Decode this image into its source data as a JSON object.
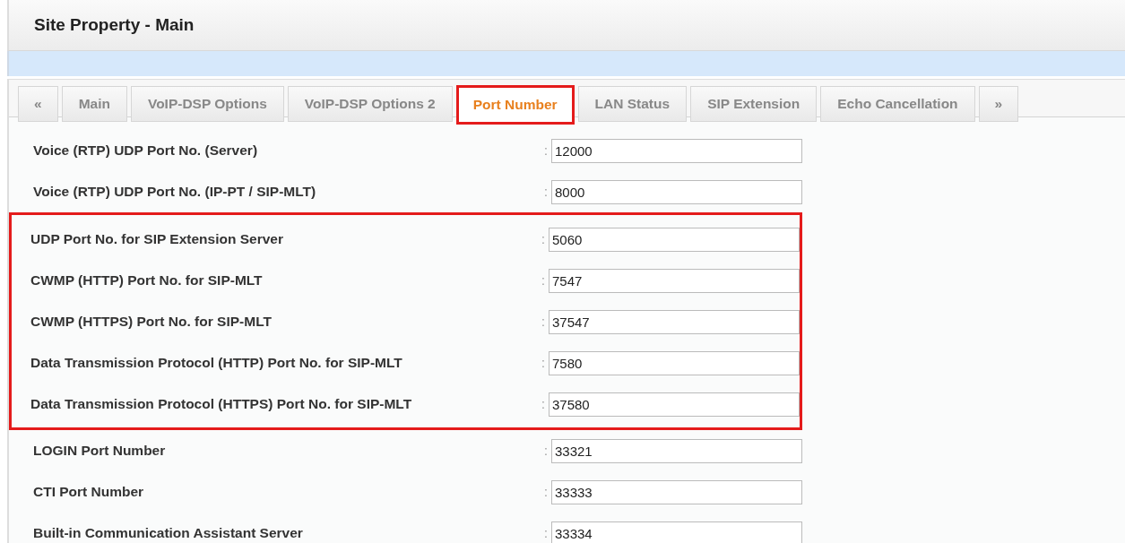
{
  "page_title": "Site Property - Main",
  "tabs": [
    {
      "label": "«",
      "kind": "arrow",
      "selected": false,
      "highlighted": false
    },
    {
      "label": "Main",
      "kind": "tab",
      "selected": false,
      "highlighted": false
    },
    {
      "label": "VoIP-DSP Options",
      "kind": "tab",
      "selected": false,
      "highlighted": false
    },
    {
      "label": "VoIP-DSP Options 2",
      "kind": "tab",
      "selected": false,
      "highlighted": false
    },
    {
      "label": "Port Number",
      "kind": "tab",
      "selected": true,
      "highlighted": true
    },
    {
      "label": "LAN Status",
      "kind": "tab",
      "selected": false,
      "highlighted": false
    },
    {
      "label": "SIP Extension",
      "kind": "tab",
      "selected": false,
      "highlighted": false
    },
    {
      "label": "Echo Cancellation",
      "kind": "tab",
      "selected": false,
      "highlighted": false
    },
    {
      "label": "»",
      "kind": "arrow",
      "selected": false,
      "highlighted": false
    }
  ],
  "field_groups": [
    {
      "highlighted": false,
      "fields": [
        {
          "label": "Voice (RTP) UDP Port No. (Server)",
          "separator": ":",
          "value": "12000"
        },
        {
          "label": "Voice (RTP) UDP Port No. (IP-PT / SIP-MLT)",
          "separator": ":",
          "value": "8000"
        }
      ]
    },
    {
      "highlighted": true,
      "fields": [
        {
          "label": "UDP Port No. for SIP Extension Server",
          "separator": ":",
          "value": "5060"
        },
        {
          "label": "CWMP (HTTP) Port No. for SIP-MLT",
          "separator": ":",
          "value": "7547"
        },
        {
          "label": "CWMP (HTTPS) Port No. for SIP-MLT",
          "separator": ":",
          "value": "37547"
        },
        {
          "label": "Data Transmission Protocol (HTTP) Port No. for SIP-MLT",
          "separator": ":",
          "value": "7580"
        },
        {
          "label": "Data Transmission Protocol (HTTPS) Port No. for SIP-MLT",
          "separator": ":",
          "value": "37580"
        }
      ]
    },
    {
      "highlighted": false,
      "fields": [
        {
          "label": "LOGIN Port Number",
          "separator": ":",
          "value": "33321"
        },
        {
          "label": "CTI Port Number",
          "separator": ":",
          "value": "33333"
        },
        {
          "label": "Built-in Communication Assistant Server",
          "separator": ":",
          "value": "33334"
        }
      ]
    }
  ]
}
